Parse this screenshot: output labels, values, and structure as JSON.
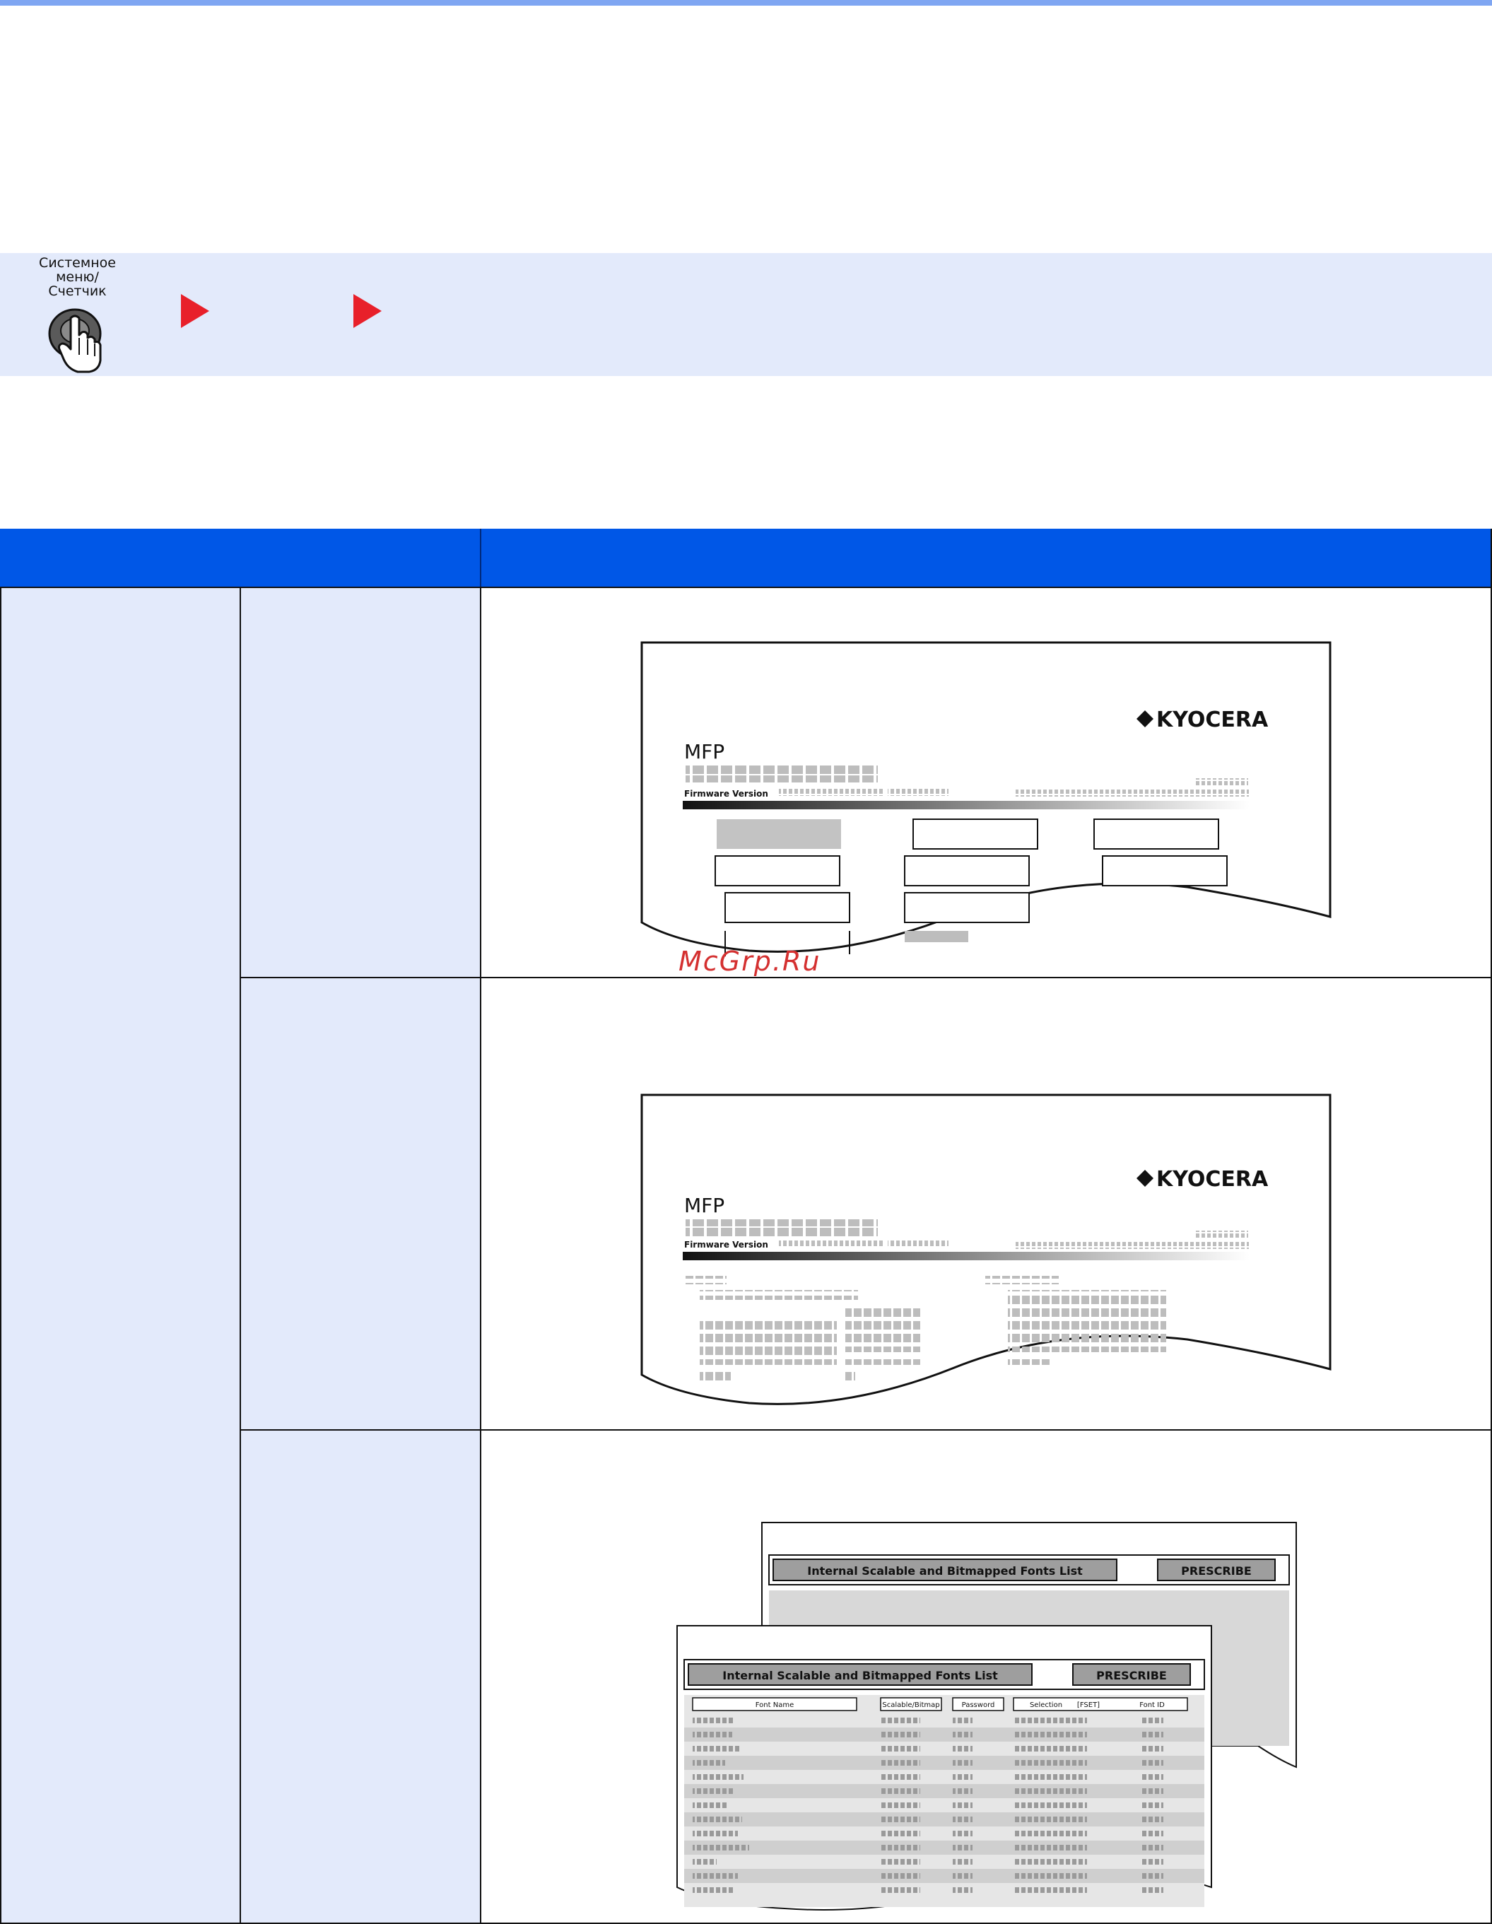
{
  "nav": {
    "key_label": "Системное\nменю/\nСчетчик"
  },
  "illustrations": {
    "status_page": {
      "brand": "KYOCERA",
      "model": "MFP",
      "firmware_label": "Firmware Version"
    },
    "service_page": {
      "brand": "KYOCERA",
      "model": "MFP",
      "firmware_label": "Firmware Version"
    },
    "font_list": {
      "title": "Internal Scalable and Bitmapped Fonts List",
      "badge": "PRESCRIBE",
      "columns": [
        "Font Name",
        "Scalable/Bitmap",
        "Password",
        "Selection",
        "[FSET]",
        "Font ID"
      ]
    }
  },
  "watermark": "McGrp.Ru",
  "colors": {
    "header_blue": "#0057e7",
    "label_fill": "#e3eafb",
    "arrow_red": "#e8202a",
    "top_rule": "#7fa6f2"
  }
}
